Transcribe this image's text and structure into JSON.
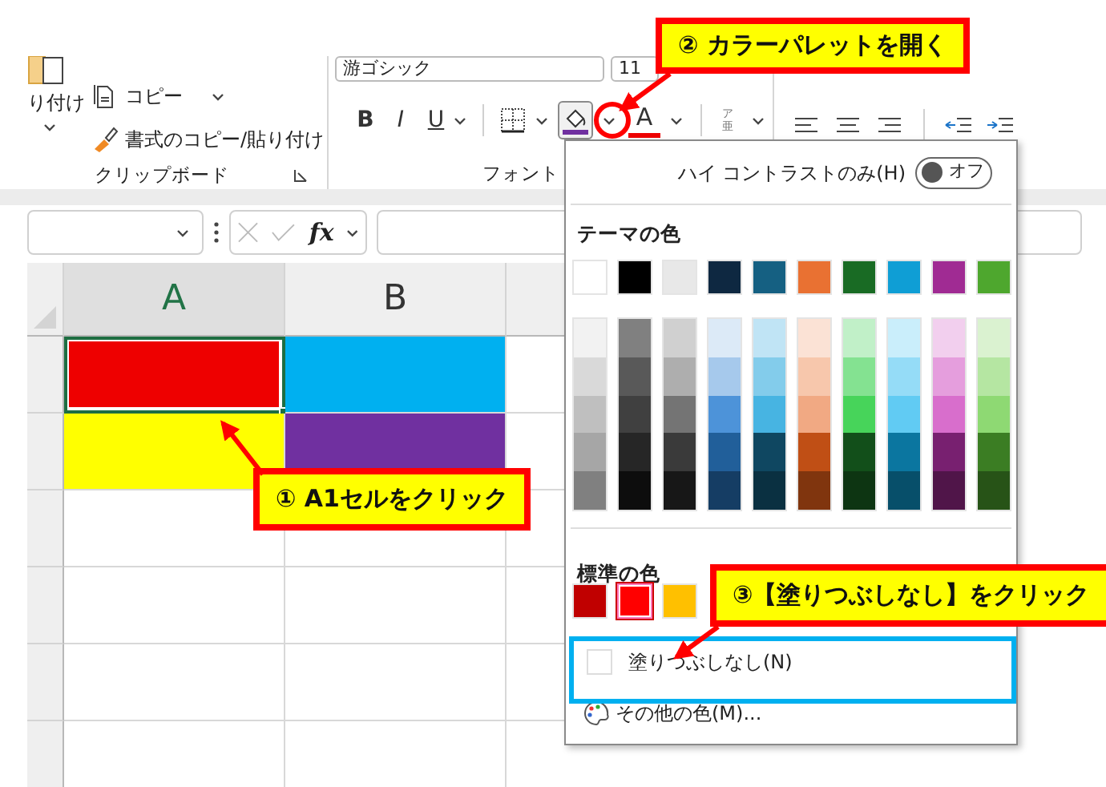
{
  "clipboard_group": {
    "paste_label": "り付け",
    "copy_label": "コピー",
    "format_painter_label": "書式のコピー/貼り付け",
    "group_label": "クリップボード"
  },
  "font_group": {
    "font_name": "游ゴシック",
    "font_size": "11",
    "format_buttons": [
      {
        "kind": "bold",
        "label": "B"
      },
      {
        "kind": "italic",
        "label": "I"
      },
      {
        "kind": "underline",
        "label": "U"
      }
    ],
    "font_color_label": "A",
    "furigana_label": "ア",
    "furigana_base": "亜",
    "group_label": "フォント"
  },
  "formula_bar": {
    "function_label": "fx"
  },
  "grid": {
    "columns": [
      {
        "label": "A",
        "selected": true
      },
      {
        "label": "B",
        "selected": false
      }
    ],
    "rows": [
      {
        "cells": [
          {
            "color": "#ee0000",
            "selected": true
          },
          {
            "color": "#00b0f0",
            "selected": false
          }
        ]
      },
      {
        "cells": [
          {
            "color": "#ffff00",
            "selected": false
          },
          {
            "color": "#7030a0",
            "selected": false
          }
        ]
      }
    ]
  },
  "color_dropdown": {
    "high_contrast": {
      "label": "ハイ コントラストのみ(H)",
      "on": false,
      "toggle_label": "オフ"
    },
    "theme_title": "テーマの色",
    "theme_colors": [
      {
        "color": "#ffffff",
        "shades": [
          {
            "color": "#f2f2f2"
          },
          {
            "color": "#d9d9d9"
          },
          {
            "color": "#bfbfbf"
          },
          {
            "color": "#a6a6a6"
          },
          {
            "color": "#808080"
          }
        ]
      },
      {
        "color": "#000000",
        "shades": [
          {
            "color": "#808080"
          },
          {
            "color": "#595959"
          },
          {
            "color": "#404040"
          },
          {
            "color": "#262626"
          },
          {
            "color": "#0d0d0d"
          }
        ]
      },
      {
        "color": "#e8e8e8",
        "shades": [
          {
            "color": "#d0d0d0"
          },
          {
            "color": "#aeaeae"
          },
          {
            "color": "#747474"
          },
          {
            "color": "#3a3a3a"
          },
          {
            "color": "#171717"
          }
        ]
      },
      {
        "color": "#0e2841",
        "shades": [
          {
            "color": "#dceaf7"
          },
          {
            "color": "#a6c9ec"
          },
          {
            "color": "#4d93d9"
          },
          {
            "color": "#215f9a"
          },
          {
            "color": "#153d64"
          }
        ]
      },
      {
        "color": "#156082",
        "shades": [
          {
            "color": "#c0e4f5"
          },
          {
            "color": "#83cceb"
          },
          {
            "color": "#47b4e2"
          },
          {
            "color": "#0f4761"
          },
          {
            "color": "#0a3041"
          }
        ]
      },
      {
        "color": "#e97132",
        "shades": [
          {
            "color": "#fbe2d5"
          },
          {
            "color": "#f7c7ac"
          },
          {
            "color": "#f1a983"
          },
          {
            "color": "#c04f15"
          },
          {
            "color": "#80350e"
          }
        ]
      },
      {
        "color": "#196b24",
        "shades": [
          {
            "color": "#c1f0c8"
          },
          {
            "color": "#84e291"
          },
          {
            "color": "#47d45a"
          },
          {
            "color": "#124f1a"
          },
          {
            "color": "#0d3512"
          }
        ]
      },
      {
        "color": "#0f9ed5",
        "shades": [
          {
            "color": "#caeefb"
          },
          {
            "color": "#95dcf7"
          },
          {
            "color": "#61cbf3"
          },
          {
            "color": "#0b76a0"
          },
          {
            "color": "#074f6a"
          }
        ]
      },
      {
        "color": "#a02b93",
        "shades": [
          {
            "color": "#f2cfee"
          },
          {
            "color": "#e59edd"
          },
          {
            "color": "#d86ecc"
          },
          {
            "color": "#782070"
          },
          {
            "color": "#501549"
          }
        ]
      },
      {
        "color": "#4ea72e",
        "shades": [
          {
            "color": "#daf2d0"
          },
          {
            "color": "#b5e6a2"
          },
          {
            "color": "#8ed973"
          },
          {
            "color": "#3b7d23"
          },
          {
            "color": "#275317"
          }
        ]
      }
    ],
    "standard_title": "標準の色",
    "standard_colors": [
      {
        "color": "#c00000",
        "selected": false
      },
      {
        "color": "#ff0000",
        "selected": true
      },
      {
        "color": "#ffc000",
        "selected": false
      }
    ],
    "no_fill": {
      "label": "塗りつぶしなし(N)"
    },
    "more_colors": {
      "label": "その他の色(M)..."
    }
  },
  "annotations": [
    {
      "text": "② カラーパレットを開く"
    },
    {
      "text": "① A1セルをクリック"
    },
    {
      "text": "③【塗りつぶしなし】をクリック"
    }
  ]
}
